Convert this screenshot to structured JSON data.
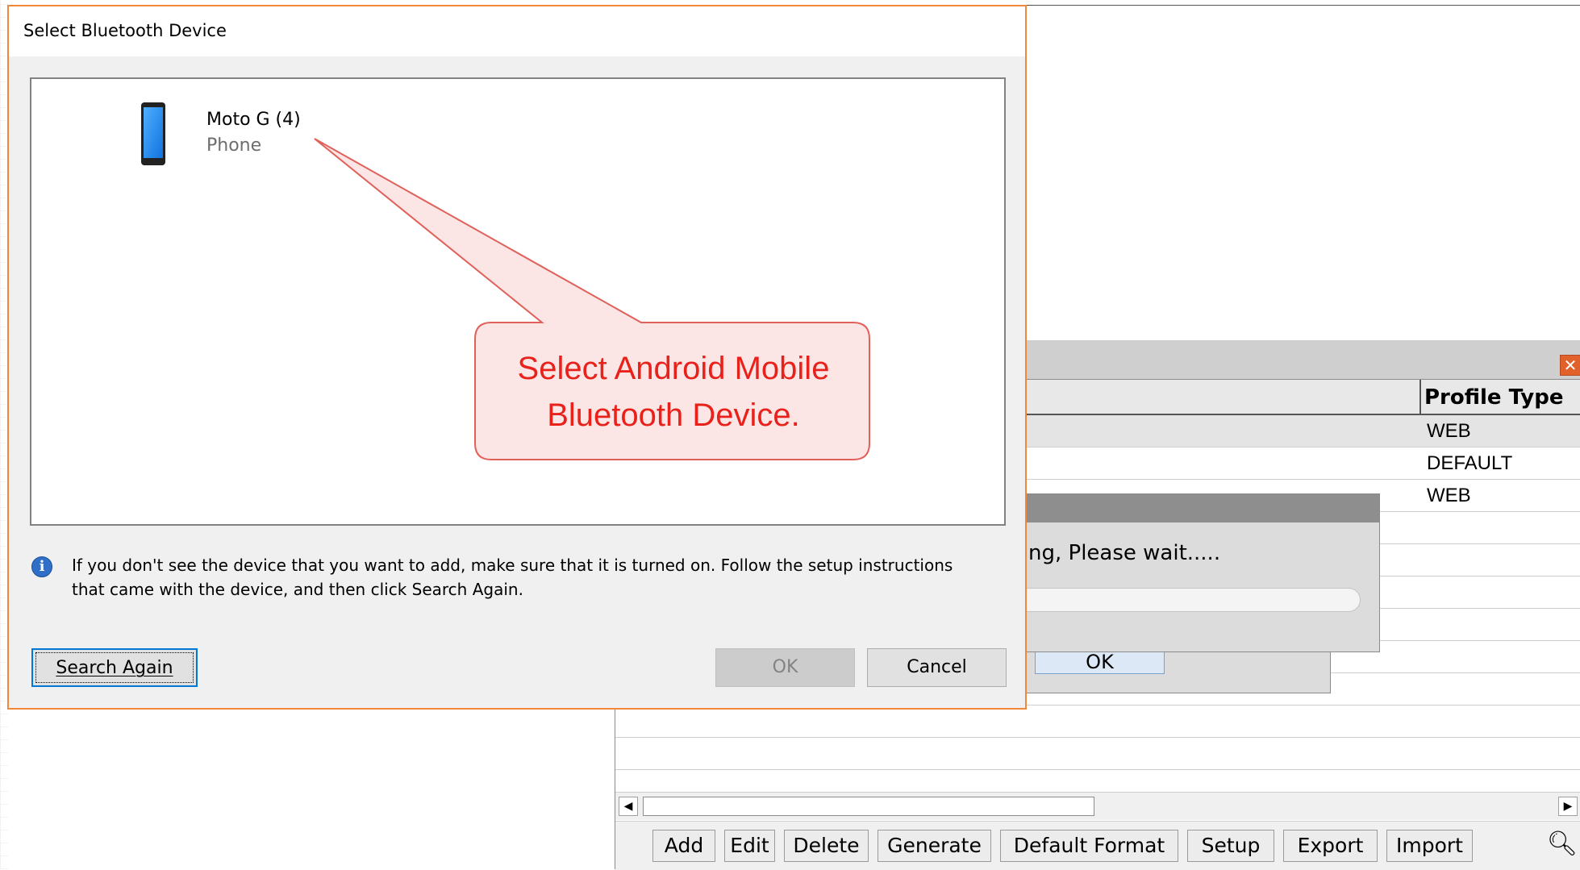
{
  "bt_dialog": {
    "title": "Select Bluetooth Device",
    "device": {
      "name": "Moto G (4)",
      "type": "Phone",
      "icon": "phone-icon"
    },
    "info_line1": "If you don't see the device that you want to add, make sure that it is turned on. Follow the setup instructions",
    "info_line2": "that came with the device, and then click Search Again.",
    "search_again_label": "Search Again",
    "ok_label": "OK",
    "cancel_label": "Cancel",
    "accent_color": "#f0883a"
  },
  "callout": {
    "line1": "Select Android Mobile",
    "line2": "Bluetooth Device.",
    "text_color": "#e8221b",
    "fill_color": "#fbe5e5",
    "border_color": "#e0605a"
  },
  "app": {
    "column_header": "Profile Type",
    "rows": [
      "WEB",
      "DEFAULT",
      "WEB",
      "",
      "",
      "",
      "",
      "",
      "",
      "",
      "",
      ""
    ],
    "close_icon": "close-icon",
    "toolbar": {
      "add": "Add",
      "edit": "Edit",
      "delete": "Delete",
      "generate": "Generate",
      "default_format": "Default Format",
      "setup": "Setup",
      "export": "Export",
      "import": "Import",
      "search_icon": "search-icon"
    },
    "progress_text": "ng, Please wait.....",
    "msg_ok_label": "OK"
  }
}
